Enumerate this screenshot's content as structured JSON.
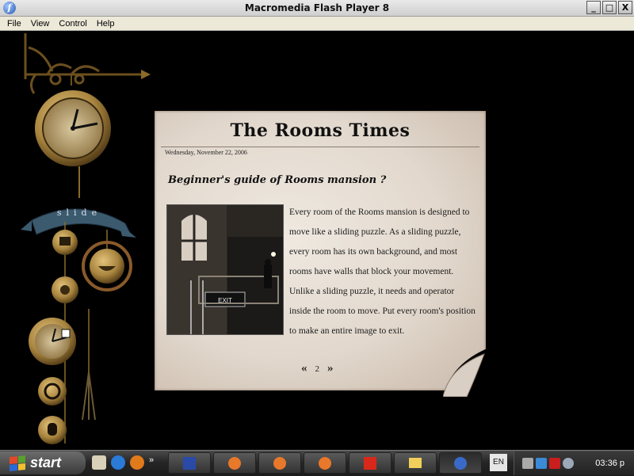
{
  "window": {
    "title": "Macromedia Flash Player 8",
    "app_icon": "f",
    "buttons": {
      "minimize": "_",
      "maximize": "□",
      "close": "X"
    }
  },
  "menu": [
    "File",
    "View",
    "Control",
    "Help"
  ],
  "ornament": {
    "banner_text": "slide"
  },
  "article": {
    "masthead": "The Rooms Times",
    "date": "Wednesday, November 22, 2006",
    "headline": "Beginner's guide of Rooms mansion ?",
    "photo_exit_label": "EXIT",
    "body": "Every room of the Rooms mansion is designed to move like a sliding puzzle. As a sliding puzzle, every room has its own background, and most rooms have walls that block your movement. Unlike a sliding puzzle, it needs and operator inside the room to move. Put every room's position to make an entire image to exit.",
    "pager": {
      "prev": "«",
      "page": "2",
      "next": "»"
    }
  },
  "taskbar": {
    "start_label": "start",
    "quick_launch_more": "»",
    "language": "EN",
    "clock": "03:36 p",
    "tasks": [
      "word-icon",
      "firefox-icon",
      "firefox-icon",
      "firefox-icon",
      "app-red-icon",
      "folder-icon",
      "flash-player-icon"
    ]
  },
  "colors": {
    "paper": "#e8e0d6",
    "brass": "#a8843e",
    "stage": "#000000",
    "taskbar": "#2a2a2a"
  }
}
